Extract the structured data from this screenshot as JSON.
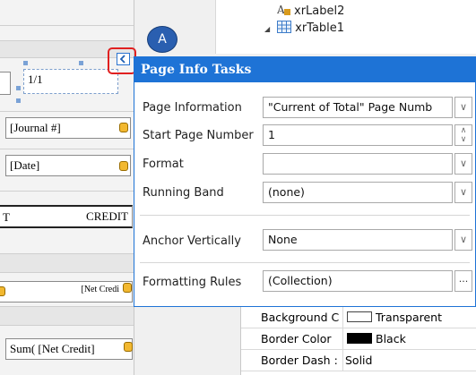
{
  "designer": {
    "page_field": "1/1",
    "journal_field": "[Journal #]",
    "date_field": "[Date]",
    "credit_header": "CREDIT",
    "t_fragment": "T",
    "net_credit_field": "[Net Credi",
    "sum_field": "Sum( [Net Credit]"
  },
  "tree": {
    "items": [
      {
        "label": "xrLabel2",
        "icon": "label-icon"
      },
      {
        "label": "xrTable1",
        "icon": "table-icon"
      }
    ]
  },
  "callout": {
    "letter": "A"
  },
  "tasks_panel": {
    "title": "Page Info Tasks",
    "rows": [
      {
        "label": "Page Information",
        "value": "\"Current of Total\" Page Numb"
      },
      {
        "label": "Start Page Number",
        "value": "1"
      },
      {
        "label": "Format",
        "value": ""
      },
      {
        "label": "Running Band",
        "value": "(none)"
      },
      {
        "label": "Anchor Vertically",
        "value": "None"
      },
      {
        "label": "Formatting Rules",
        "value": "(Collection)"
      }
    ],
    "ellipsis": "..."
  },
  "property_grid": {
    "rows": [
      {
        "name": "Background C",
        "value": "Transparent",
        "swatch": "#ffffff"
      },
      {
        "name": "Border Color",
        "value": "Black",
        "swatch": "#000000"
      },
      {
        "name": "Border Dash :",
        "value": "Solid"
      }
    ]
  },
  "colors": {
    "accent": "#1e73d6",
    "highlight": "#e02020",
    "callout": "#2a5fb0"
  }
}
